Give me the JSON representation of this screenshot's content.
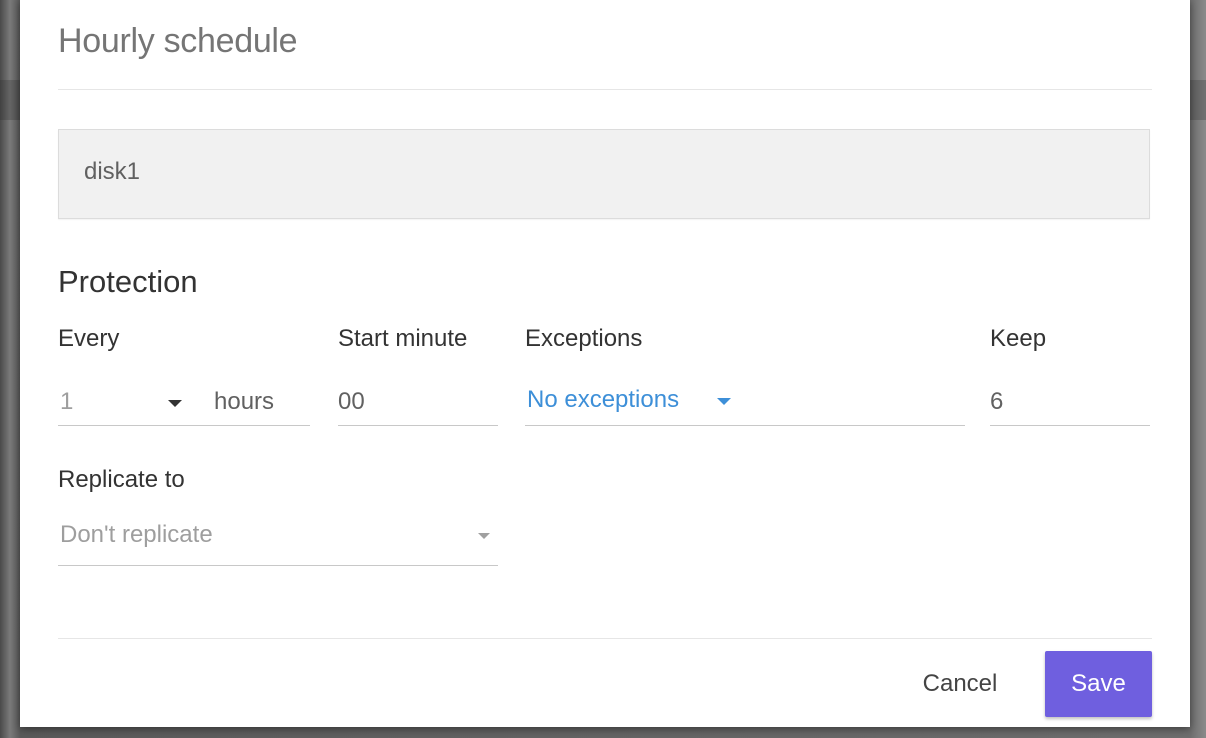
{
  "dialog": {
    "title": "Hourly schedule",
    "disk_name": "disk1"
  },
  "protection": {
    "section_title": "Protection",
    "every": {
      "label": "Every",
      "value": "1",
      "unit": "hours"
    },
    "start_minute": {
      "label": "Start minute",
      "value": "00"
    },
    "exceptions": {
      "label": "Exceptions",
      "value": "No exceptions"
    },
    "keep": {
      "label": "Keep",
      "value": "6"
    },
    "replicate": {
      "label": "Replicate to",
      "value": "Don't replicate"
    }
  },
  "footer": {
    "cancel_label": "Cancel",
    "save_label": "Save"
  },
  "colors": {
    "accent": "#6f5fdf",
    "link": "#3d8fd8"
  },
  "icons": {
    "dropdown": "chevron-down-icon"
  }
}
